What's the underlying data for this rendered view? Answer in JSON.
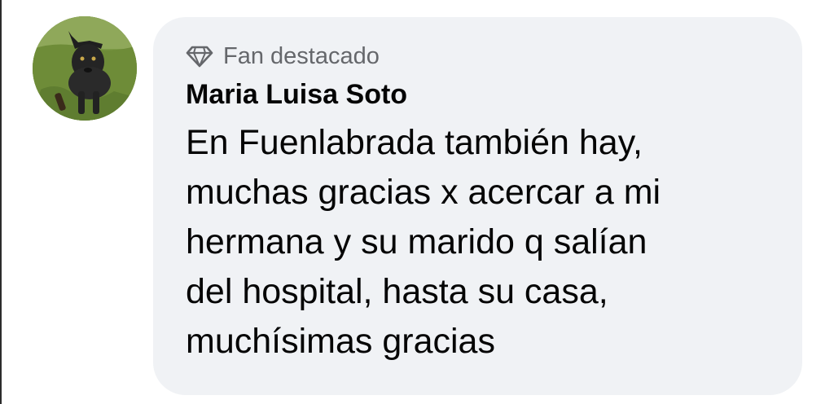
{
  "comment": {
    "avatar_icon": "dog-photo-avatar",
    "badge": {
      "icon": "diamond-icon",
      "label": "Fan destacado"
    },
    "author_name": "Maria Luisa Soto",
    "text": "En Fuenlabrada también hay,\nmuchas gracias x acercar a mi\nhermana y su marido q salían\ndel hospital, hasta su casa,\nmuchísimas gracias"
  },
  "colors": {
    "bubble_background": "#f0f2f5",
    "badge_text": "#65676b",
    "primary_text": "#050505"
  }
}
